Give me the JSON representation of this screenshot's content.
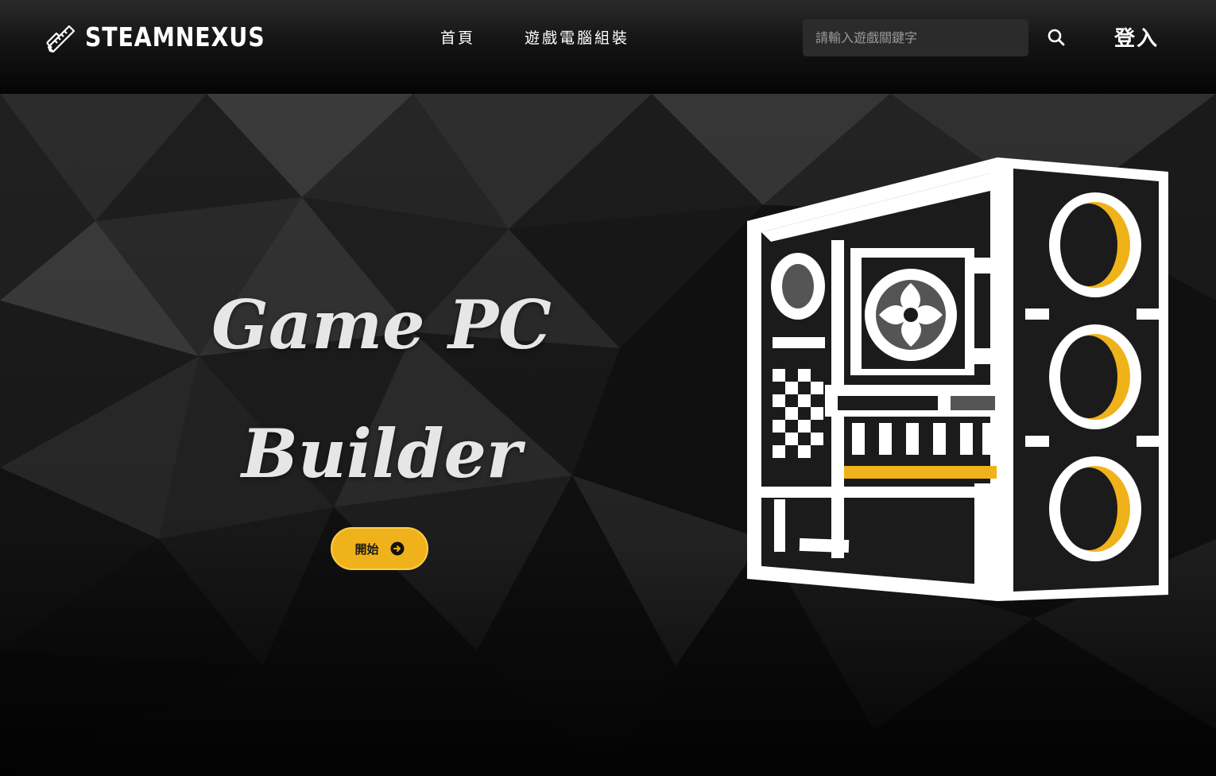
{
  "header": {
    "logo_text": "STEAMNEXUS",
    "logo_icon": "pencil-ruler-icon",
    "nav": [
      {
        "label": "首頁"
      },
      {
        "label": "遊戲電腦組裝"
      }
    ],
    "search": {
      "placeholder": "請輸入遊戲關鍵字",
      "value": ""
    },
    "search_icon": "search-icon",
    "login_label": "登入"
  },
  "hero": {
    "title_line1": "Game PC",
    "title_line2": "Builder",
    "start_label": "開始",
    "start_icon": "arrow-right-circle-icon",
    "illustration": "pc-case-icon"
  },
  "colors": {
    "accent": "#f0b21a",
    "header_bg": "#1a1a1a",
    "search_bg": "#2b2b2b",
    "text": "#ffffff"
  }
}
